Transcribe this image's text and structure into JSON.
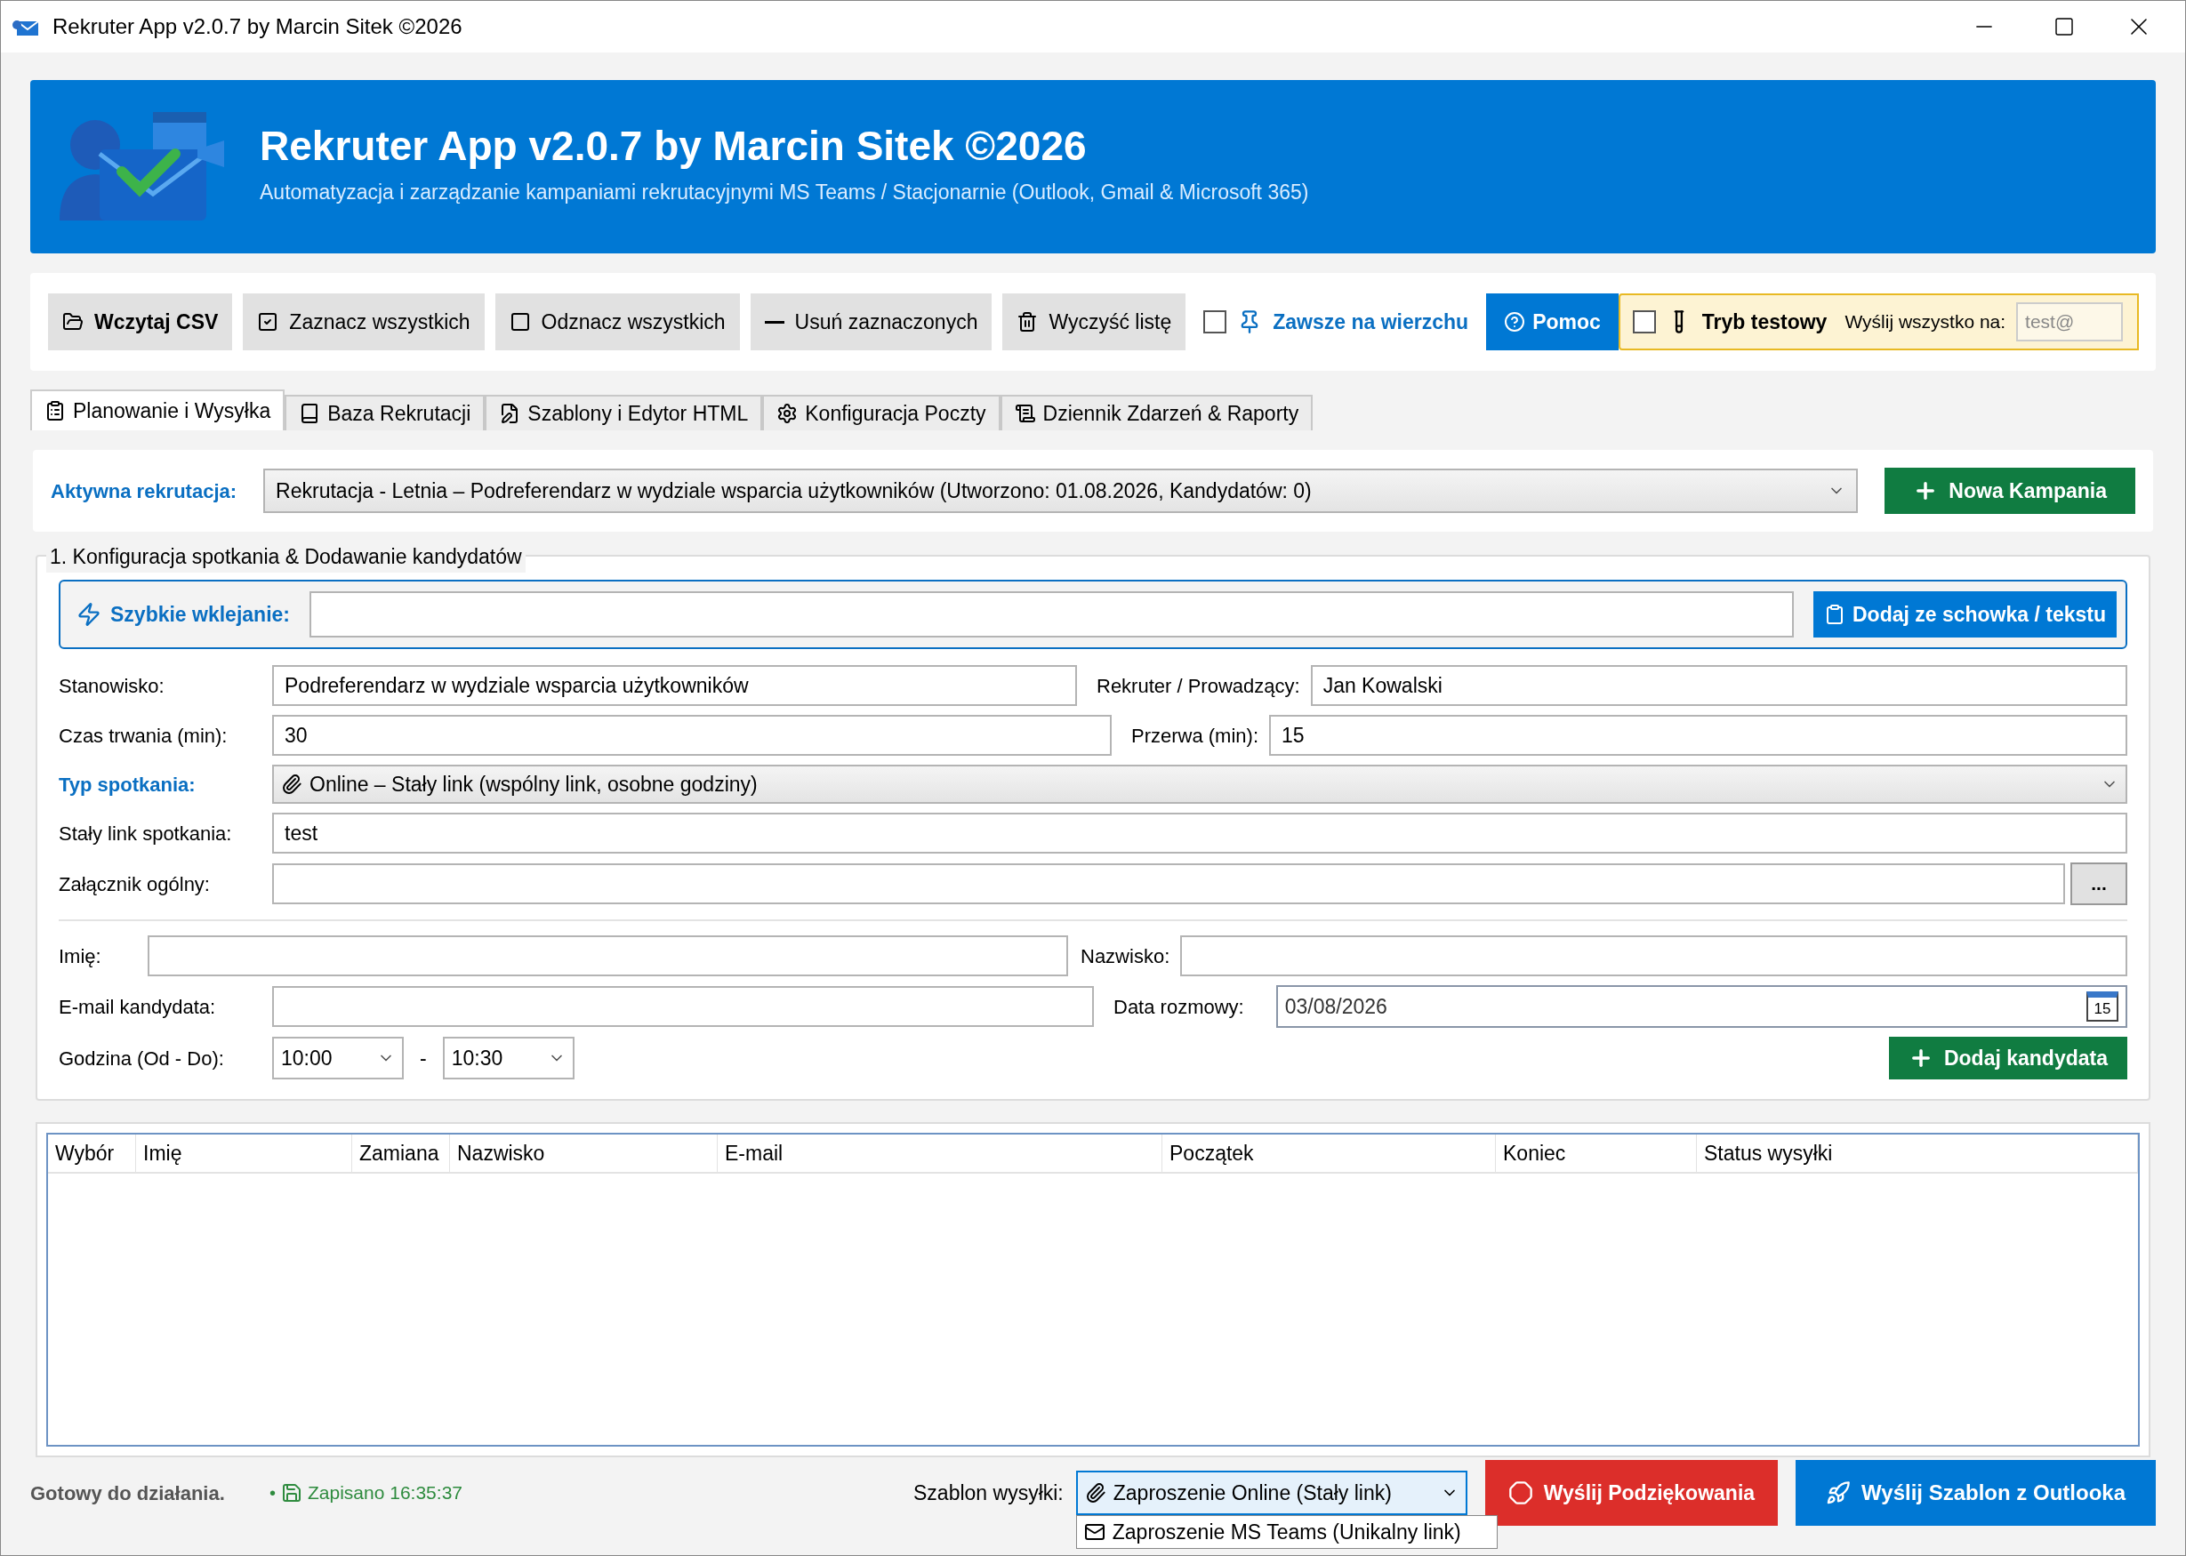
{
  "window": {
    "title": "Rekruter App v2.0.7 by Marcin Sitek ©2026"
  },
  "header": {
    "title": "Rekruter App v2.0.7 by Marcin Sitek ©2026",
    "subtitle": "Automatyzacja i zarządzanie kampaniami rekrutacyjnymi MS Teams / Stacjonarnie (Outlook, Gmail & Microsoft 365)"
  },
  "toolbar": {
    "buttons": [
      {
        "label": "Wczytaj CSV",
        "kind": "load",
        "bold": true
      },
      {
        "label": "Zaznacz wszystkich",
        "kind": "check_all",
        "bold": false
      },
      {
        "label": "Odznacz wszystkich",
        "kind": "uncheck_all",
        "bold": false
      },
      {
        "label": "Usuń zaznaczonych",
        "kind": "remove",
        "bold": false
      },
      {
        "label": "Wyczyść listę",
        "kind": "clear",
        "bold": false
      }
    ],
    "always_on_top": {
      "label": "Zawsze na wierzchu",
      "checked": false
    },
    "help": {
      "label": "Pomoc"
    },
    "test_mode": {
      "label": "Tryb testowy",
      "checked": false,
      "send_all_label": "Wyślij wszystko na:",
      "placeholder": "test@"
    }
  },
  "tabs": [
    {
      "label": "Planowanie i Wysyłka",
      "selected": true
    },
    {
      "label": "Baza Rekrutacji",
      "selected": false
    },
    {
      "label": "Szablony i Edytor HTML",
      "selected": false
    },
    {
      "label": "Konfiguracja Poczty",
      "selected": false
    },
    {
      "label": "Dziennik Zdarzeń & Raporty",
      "selected": false
    }
  ],
  "campaign": {
    "label": "Aktywna rekrutacja:",
    "value": "Rekrutacja - Letnia – Podreferendarz w wydziale wsparcia użytkowników (Utworzono: 01.08.2026, Kandydatów: 0)",
    "button": "Nowa Kampania"
  },
  "meeting": {
    "title": "1. Konfiguracja spotkania & Dodawanie kandydatów",
    "quick_paste": {
      "label": "Szybkie wklejanie:",
      "button": "Dodaj ze schowka / tekstu"
    },
    "position": {
      "label": "Stanowisko:",
      "value": "Podreferendarz w wydziale wsparcia użytkowników"
    },
    "recruiter": {
      "label": "Rekruter / Prowadzący:",
      "value": "Jan Kowalski"
    },
    "duration": {
      "label": "Czas trwania (min):",
      "value": "30"
    },
    "break": {
      "label": "Przerwa (min):",
      "value": "15"
    },
    "meeting_type": {
      "label": "Typ spotkania:",
      "value": "Online – Stały link (wspólny link, osobne godziny)"
    },
    "fixed_link": {
      "label": "Stały link spotkania:",
      "value": "test"
    },
    "attachment": {
      "label": "Załącznik ogólny:",
      "button": "..."
    },
    "first_name": {
      "label": "Imię:"
    },
    "last_name": {
      "label": "Nazwisko:"
    },
    "email": {
      "label": "E-mail kandydata:"
    },
    "date": {
      "label": "Data rozmowy:",
      "value": "03/08/2026",
      "calendar_day": "15"
    },
    "time": {
      "label": "Godzina (Od - Do):",
      "from": "10:00",
      "separator": "-",
      "to": "10:30"
    },
    "add_button": "Dodaj kandydata"
  },
  "table": {
    "columns": [
      "Wybór",
      "Imię",
      "Zamiana",
      "Nazwisko",
      "E-mail",
      "Początek",
      "Koniec",
      "Status wysyłki"
    ]
  },
  "status_bar": {
    "status": "Gotowy do działania.",
    "bullet": "•",
    "saved": "Zapisano 16:35:37",
    "template_label": "Szablon wysyłki:",
    "template_value": "Zaproszenie Online (Stały link)",
    "template_option": "Zaproszenie MS Teams (Unikalny link)",
    "thanks_button": "Wyślij Podziękowania",
    "send_button": "Wyślij Szablon z Outlooka"
  }
}
